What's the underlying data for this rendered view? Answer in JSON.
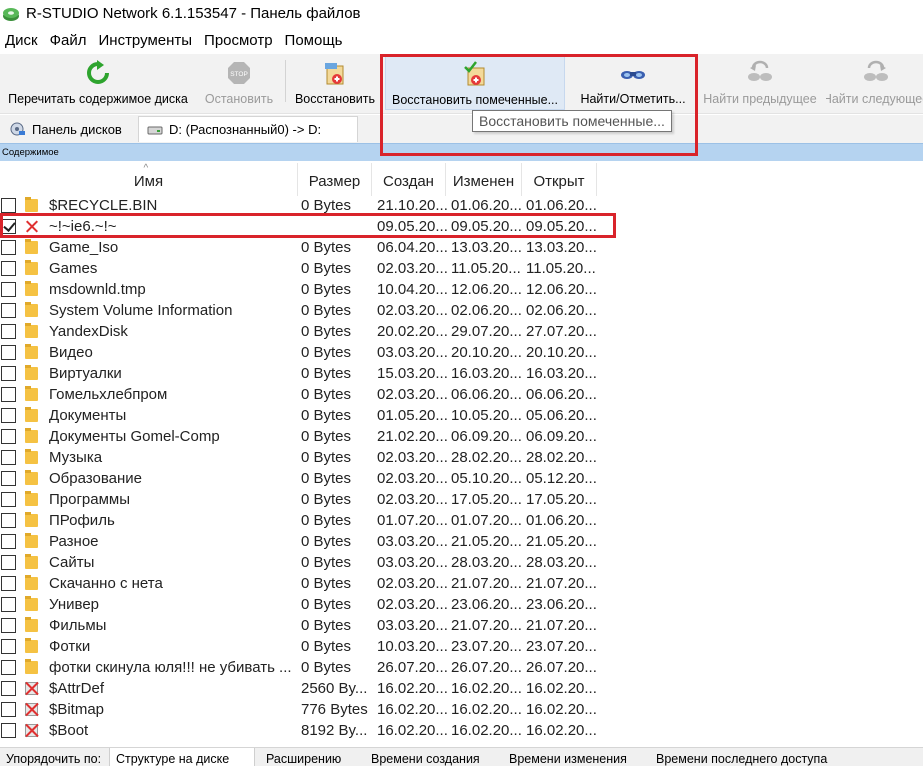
{
  "window": {
    "title": "R-STUDIO Network 6.1.153547 - Панель файлов"
  },
  "menu": [
    "Диск",
    "Файл",
    "Инструменты",
    "Просмотр",
    "Помощь"
  ],
  "toolbar": {
    "rescan": "Перечитать содержимое диска",
    "stop": "Остановить",
    "recover": "Восстановить",
    "recover_marked": "Восстановить помеченные...",
    "find_mark": "Найти/Отметить...",
    "find_prev": "Найти предыдущее",
    "find_next": "Найти следующее"
  },
  "tooltip": "Восстановить помеченные...",
  "tabs": {
    "disk_panel": "Панель дисков",
    "drive": "D: (Распознанный0) -> D:"
  },
  "panel_label": "Содержимое",
  "columns": {
    "name": "Имя",
    "size": "Размер",
    "created": "Создан",
    "modified": "Изменен",
    "accessed": "Открыт"
  },
  "rows": [
    {
      "checked": false,
      "icon": "folder-icon",
      "name": "$RECYCLE.BIN",
      "size": "0 Bytes",
      "created": "21.10.20...",
      "modified": "01.06.20...",
      "accessed": "01.06.20..."
    },
    {
      "checked": true,
      "icon": "deleted-file-icon",
      "name": "~!~ie6.~!~",
      "size": "",
      "created": "09.05.20...",
      "modified": "09.05.20...",
      "accessed": "09.05.20..."
    },
    {
      "checked": false,
      "icon": "folder-icon",
      "name": "Game_Iso",
      "size": "0 Bytes",
      "created": "06.04.20...",
      "modified": "13.03.20...",
      "accessed": "13.03.20..."
    },
    {
      "checked": false,
      "icon": "folder-icon",
      "name": "Games",
      "size": "0 Bytes",
      "created": "02.03.20...",
      "modified": "11.05.20...",
      "accessed": "11.05.20..."
    },
    {
      "checked": false,
      "icon": "folder-icon",
      "name": "msdownld.tmp",
      "size": "0 Bytes",
      "created": "10.04.20...",
      "modified": "12.06.20...",
      "accessed": "12.06.20..."
    },
    {
      "checked": false,
      "icon": "folder-icon",
      "name": "System Volume Information",
      "size": "0 Bytes",
      "created": "02.03.20...",
      "modified": "02.06.20...",
      "accessed": "02.06.20..."
    },
    {
      "checked": false,
      "icon": "folder-icon",
      "name": "YandexDisk",
      "size": "0 Bytes",
      "created": "20.02.20...",
      "modified": "29.07.20...",
      "accessed": "27.07.20..."
    },
    {
      "checked": false,
      "icon": "folder-icon",
      "name": "Видео",
      "size": "0 Bytes",
      "created": "03.03.20...",
      "modified": "20.10.20...",
      "accessed": "20.10.20..."
    },
    {
      "checked": false,
      "icon": "folder-icon",
      "name": "Виртуалки",
      "size": "0 Bytes",
      "created": "15.03.20...",
      "modified": "16.03.20...",
      "accessed": "16.03.20..."
    },
    {
      "checked": false,
      "icon": "folder-icon",
      "name": "Гомельхлебпром",
      "size": "0 Bytes",
      "created": "02.03.20...",
      "modified": "06.06.20...",
      "accessed": "06.06.20..."
    },
    {
      "checked": false,
      "icon": "folder-icon",
      "name": "Документы",
      "size": "0 Bytes",
      "created": "01.05.20...",
      "modified": "10.05.20...",
      "accessed": "05.06.20..."
    },
    {
      "checked": false,
      "icon": "folder-icon",
      "name": "Документы Gomel-Comp",
      "size": "0 Bytes",
      "created": "21.02.20...",
      "modified": "06.09.20...",
      "accessed": "06.09.20..."
    },
    {
      "checked": false,
      "icon": "folder-icon",
      "name": "Музыка",
      "size": "0 Bytes",
      "created": "02.03.20...",
      "modified": "28.02.20...",
      "accessed": "28.02.20..."
    },
    {
      "checked": false,
      "icon": "folder-icon",
      "name": "Образование",
      "size": "0 Bytes",
      "created": "02.03.20...",
      "modified": "05.10.20...",
      "accessed": "05.12.20..."
    },
    {
      "checked": false,
      "icon": "folder-icon",
      "name": "Программы",
      "size": "0 Bytes",
      "created": "02.03.20...",
      "modified": "17.05.20...",
      "accessed": "17.05.20..."
    },
    {
      "checked": false,
      "icon": "folder-icon",
      "name": "ПРофиль",
      "size": "0 Bytes",
      "created": "01.07.20...",
      "modified": "01.07.20...",
      "accessed": "01.06.20..."
    },
    {
      "checked": false,
      "icon": "folder-icon",
      "name": "Разное",
      "size": "0 Bytes",
      "created": "03.03.20...",
      "modified": "21.05.20...",
      "accessed": "21.05.20..."
    },
    {
      "checked": false,
      "icon": "folder-icon",
      "name": "Сайты",
      "size": "0 Bytes",
      "created": "03.03.20...",
      "modified": "28.03.20...",
      "accessed": "28.03.20..."
    },
    {
      "checked": false,
      "icon": "folder-icon",
      "name": "Скачанно с нета",
      "size": "0 Bytes",
      "created": "02.03.20...",
      "modified": "21.07.20...",
      "accessed": "21.07.20..."
    },
    {
      "checked": false,
      "icon": "folder-icon",
      "name": "Универ",
      "size": "0 Bytes",
      "created": "02.03.20...",
      "modified": "23.06.20...",
      "accessed": "23.06.20..."
    },
    {
      "checked": false,
      "icon": "folder-icon",
      "name": "Фильмы",
      "size": "0 Bytes",
      "created": "03.03.20...",
      "modified": "21.07.20...",
      "accessed": "21.07.20..."
    },
    {
      "checked": false,
      "icon": "folder-icon",
      "name": "Фотки",
      "size": "0 Bytes",
      "created": "10.03.20...",
      "modified": "23.07.20...",
      "accessed": "23.07.20..."
    },
    {
      "checked": false,
      "icon": "folder-icon",
      "name": "фотки скинула юля!!! не убивать ...",
      "size": "0 Bytes",
      "created": "26.07.20...",
      "modified": "26.07.20...",
      "accessed": "26.07.20..."
    },
    {
      "checked": false,
      "icon": "system-file-icon",
      "name": "$AttrDef",
      "size": "2560 By...",
      "created": "16.02.20...",
      "modified": "16.02.20...",
      "accessed": "16.02.20..."
    },
    {
      "checked": false,
      "icon": "system-file-icon",
      "name": "$Bitmap",
      "size": "776 Bytes",
      "created": "16.02.20...",
      "modified": "16.02.20...",
      "accessed": "16.02.20..."
    },
    {
      "checked": false,
      "icon": "system-file-icon",
      "name": "$Boot",
      "size": "8192 By...",
      "created": "16.02.20...",
      "modified": "16.02.20...",
      "accessed": "16.02.20..."
    }
  ],
  "statusbar": {
    "sort_label": "Упорядочить по:",
    "items": [
      "Структуре на диске",
      "Расширению",
      "Времени создания",
      "Времени изменения",
      "Времени последнего доступа"
    ]
  }
}
